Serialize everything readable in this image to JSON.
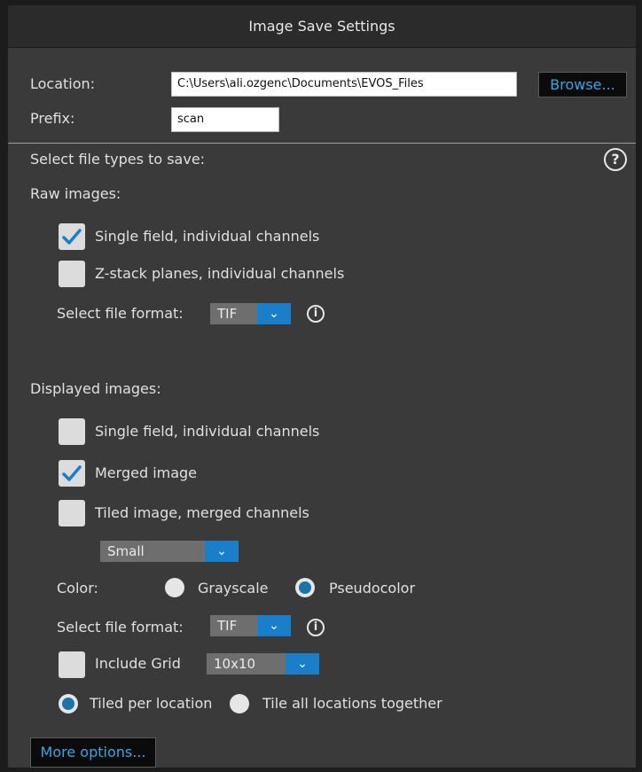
{
  "window": {
    "title": "Image Save Settings"
  },
  "location": {
    "label": "Location:",
    "value": "C:\\Users\\ali.ozgenc\\Documents\\EVOS_Files",
    "browse_label": "Browse..."
  },
  "prefix": {
    "label": "Prefix:",
    "value": "scan"
  },
  "file_types": {
    "heading": "Select file types to save:",
    "help_icon": "question-circle-icon"
  },
  "raw": {
    "heading": "Raw images:",
    "single_field": {
      "label": "Single field, individual channels",
      "checked": true
    },
    "zstack": {
      "label": "Z-stack planes, individual channels",
      "checked": false
    },
    "format_label": "Select file format:",
    "format_value": "TIF"
  },
  "displayed": {
    "heading": "Displayed images:",
    "single_field": {
      "label": "Single field, individual channels",
      "checked": false
    },
    "merged": {
      "label": "Merged image",
      "checked": true
    },
    "tiled": {
      "label": "Tiled image, merged channels",
      "checked": false
    },
    "tile_size": "Small",
    "color_label": "Color:",
    "grayscale_label": "Grayscale",
    "pseudocolor_label": "Pseudocolor",
    "color_selected": "Pseudocolor",
    "format_label": "Select file format:",
    "format_value": "TIF",
    "include_grid": {
      "label": "Include Grid",
      "checked": false
    },
    "grid_value": "10x10",
    "tiled_per_location_label": "Tiled per location",
    "tile_all_label": "Tile all locations together",
    "tile_mode_selected": "Tiled per location"
  },
  "footer": {
    "more_options_label": "More options..."
  },
  "colors": {
    "accent": "#1a7fc8",
    "link_text": "#39a6e6",
    "panel_bg": "#3a3a3a"
  }
}
